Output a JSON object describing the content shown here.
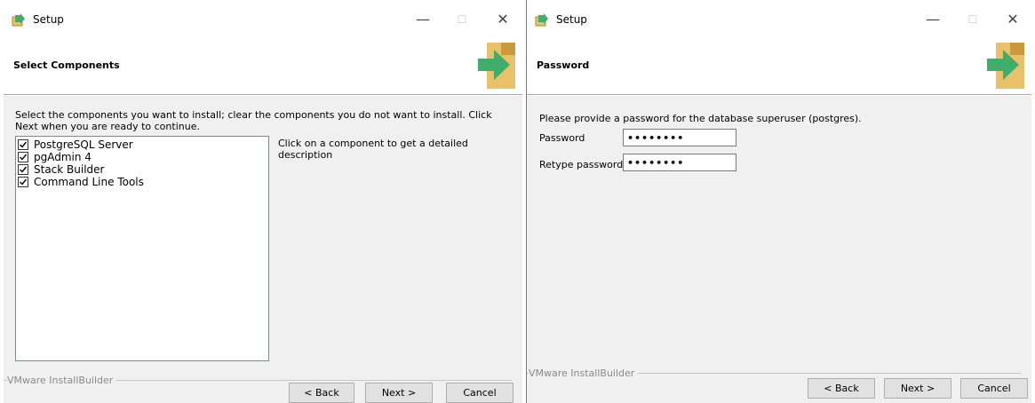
{
  "left": {
    "window_title": "Setup",
    "controls": {
      "minimize": "—",
      "maximize": "☐",
      "close": "✕"
    },
    "header_title": "Select Components",
    "instruction": "Select the components you want to install; clear the components you do not want to install. Click Next when you are ready to continue.",
    "components": [
      {
        "label": "PostgreSQL Server",
        "checked": true
      },
      {
        "label": "pgAdmin 4",
        "checked": true
      },
      {
        "label": "Stack Builder",
        "checked": true
      },
      {
        "label": "Command Line Tools",
        "checked": true
      }
    ],
    "description": "Click on a component to get a detailed description",
    "branding": "VMware InstallBuilder",
    "buttons": {
      "back": "< Back",
      "next": "Next >",
      "cancel": "Cancel"
    }
  },
  "right": {
    "window_title": "Setup",
    "controls": {
      "minimize": "—",
      "maximize": "☐",
      "close": "✕"
    },
    "header_title": "Password",
    "prompt": "Please provide a password for the database superuser (postgres).",
    "password_label": "Password",
    "password_value": "••••••••",
    "retype_label": "Retype password",
    "retype_value": "••••••••",
    "branding": "VMware InstallBuilder",
    "buttons": {
      "back": "< Back",
      "next": "Next >",
      "cancel": "Cancel"
    }
  },
  "colors": {
    "box": "#e8c16a",
    "box_dark": "#c9993c",
    "arrow": "#3fae6a",
    "body_bg": "#f0f0f0"
  }
}
